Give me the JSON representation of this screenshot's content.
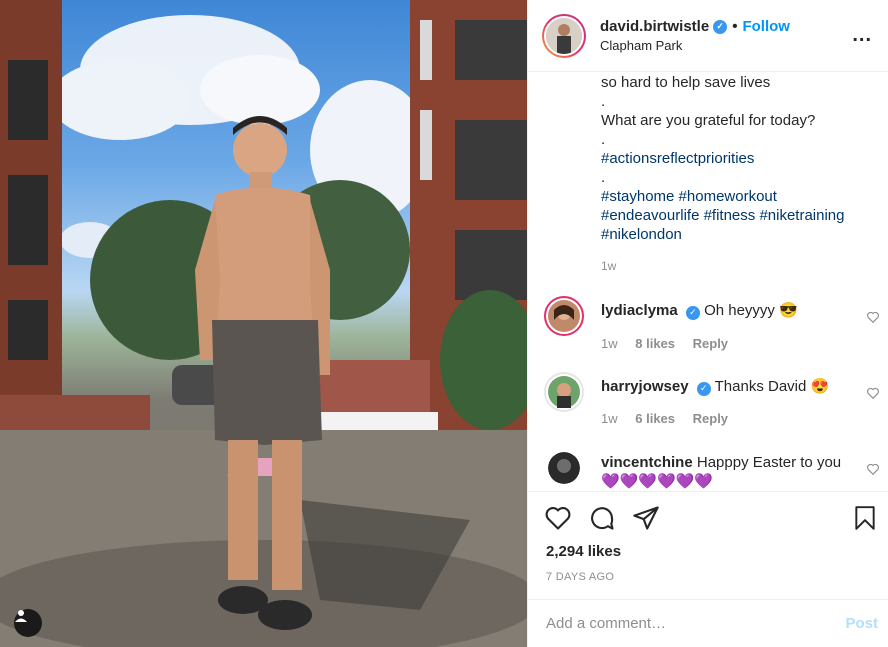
{
  "header": {
    "username": "david.birtwistle",
    "follow_label": "Follow",
    "dot": "•",
    "location": "Clapham Park",
    "more_label": "..."
  },
  "caption": {
    "lines": [
      "so hard to help save lives",
      ".",
      "What are you grateful for today?",
      ".",
      "#actionsreflectpriorities",
      ".",
      "#stayhome #homeworkout",
      "#endeavourlife #fitness #niketraining",
      "#nikelondon"
    ],
    "time": "1w"
  },
  "comments": [
    {
      "user": "lydiaclyma",
      "text": "Oh heyyyy 😎",
      "time": "1w",
      "likes": "8 likes",
      "reply": "Reply"
    },
    {
      "user": "harryjowsey",
      "text": "Thanks David 😍",
      "time": "1w",
      "likes": "6 likes",
      "reply": "Reply"
    },
    {
      "user": "vincentchine",
      "text": "Happpy Easter to you💜💜💜💜💜💜"
    }
  ],
  "actions": {
    "likes": "2,294 likes",
    "date": "7 DAYS AGO"
  },
  "add_comment": {
    "placeholder": "Add a comment…",
    "post_label": "Post"
  },
  "colors": {
    "accent": "#0095f6",
    "hashtag": "#00376b",
    "muted": "#8e8e8e",
    "post_disabled": "#b2dffc"
  }
}
